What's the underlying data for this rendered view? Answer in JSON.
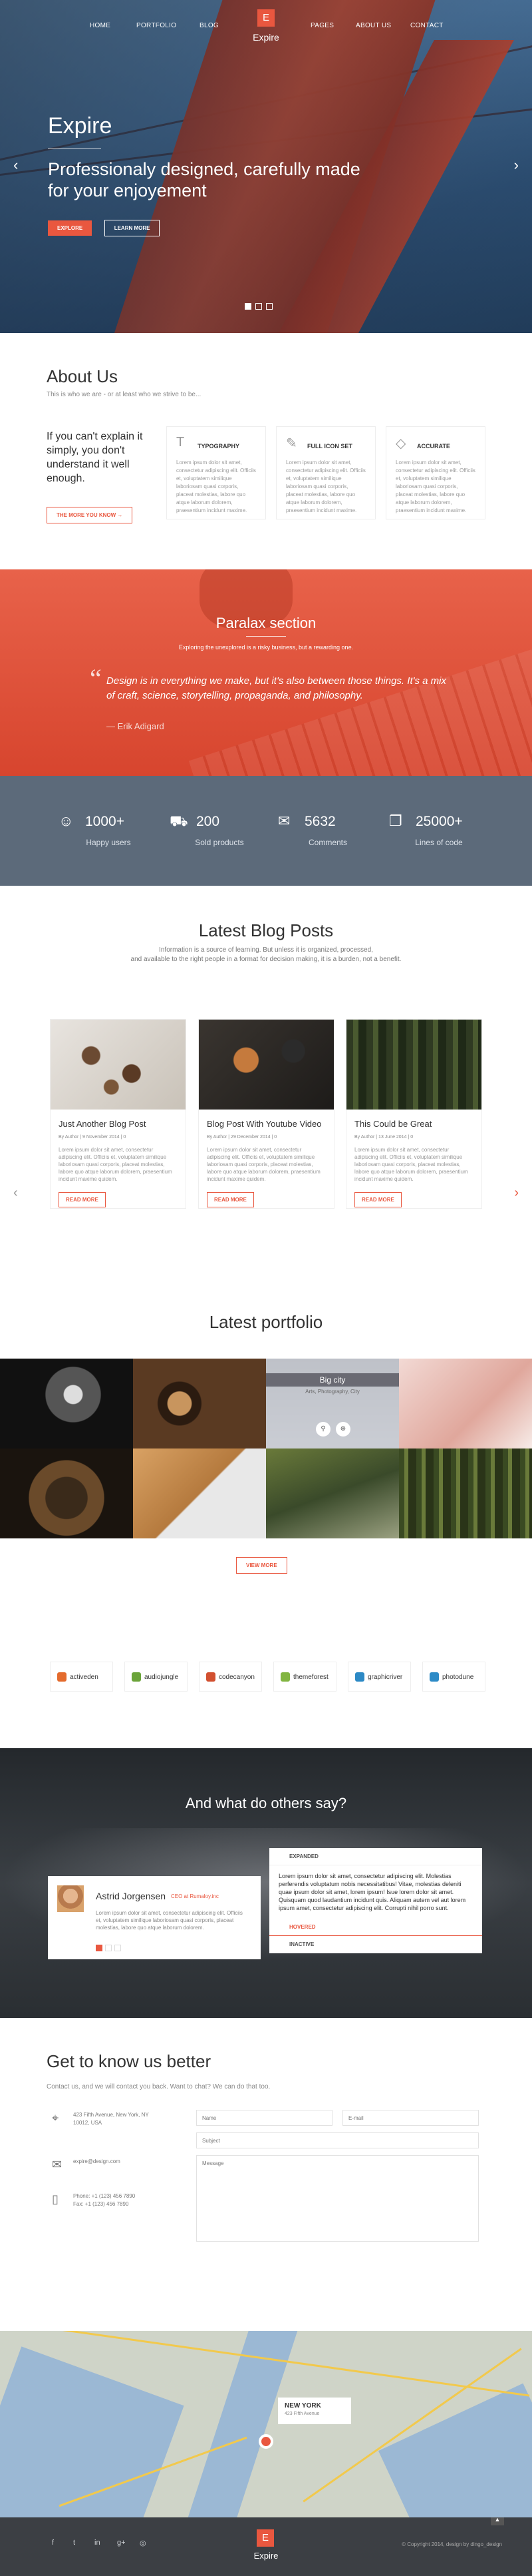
{
  "nav": {
    "left": [
      "HOME",
      "PORTFOLIO",
      "BLOG"
    ],
    "right": [
      "PAGES",
      "ABOUT US",
      "CONTACT"
    ],
    "logo_letter": "E",
    "logo_text": "Expire"
  },
  "hero": {
    "title": "Expire",
    "tagline_1": "Professionaly designed, carefully made",
    "tagline_2": "for your enjoyement",
    "btn_explore": "EXPLORE",
    "btn_learn": "LEARN MORE",
    "arrow_left": "‹",
    "arrow_right": "›"
  },
  "about": {
    "title": "About Us",
    "subtitle": "This is who we are - or at least who we strive to be...",
    "lead": "If you can't explain it simply, you don't understand it well enough.",
    "btn": "THE MORE YOU KNOW →",
    "features": [
      {
        "icon": "typography-icon",
        "glyph": "T",
        "title": "TYPOGRAPHY",
        "text": "Lorem ipsum dolor sit amet, consectetur adipiscing elit. Officiis et, voluptatem similique laboriosam quasi corporis, placeat molestias, labore quo atque laborum dolorem, praesentium incidunt maxime."
      },
      {
        "icon": "icon-set-icon",
        "glyph": "✎",
        "title": "FULL ICON SET",
        "text": "Lorem ipsum dolor sit amet, consectetur adipiscing elit. Officiis et, voluptatem similique laboriosam quasi corporis, placeat molestias, labore quo atque laborum dolorem, praesentium incidunt maxime."
      },
      {
        "icon": "accurate-icon",
        "glyph": "◇",
        "title": "ACCURATE",
        "text": "Lorem ipsum dolor sit amet, consectetur adipiscing elit. Officiis et, voluptatem similique laboriosam quasi corporis, placeat molestias, labore quo atque laborum dolorem, praesentium incidunt maxime."
      }
    ]
  },
  "parallax": {
    "title": "Paralax section",
    "subtitle": "Exploring the unexplored is a risky business, but a rewarding one.",
    "quote_mark": "“",
    "quote": "Design is in everything we make, but it's also between those things. It's a mix of craft, science, storytelling, propaganda, and philosophy.",
    "author": "— Erik Adigard"
  },
  "stats": [
    {
      "icon": "user-icon",
      "glyph": "☺",
      "num": "1000+",
      "label": "Happy users"
    },
    {
      "icon": "product-icon",
      "glyph": "⛟",
      "num": "200",
      "label": "Sold products"
    },
    {
      "icon": "comment-icon",
      "glyph": "✉",
      "num": "5632",
      "label": "Comments"
    },
    {
      "icon": "code-icon",
      "glyph": "❐",
      "num": "25000+",
      "label": "Lines of code"
    }
  ],
  "blog": {
    "title": "Latest Blog Posts",
    "desc_1": "Information is a source of learning. But unless it is organized, processed,",
    "desc_2": "and available to the right people in a format for decision making, it is a burden, not a benefit.",
    "arrow_left": "‹",
    "arrow_right": "›",
    "posts": [
      {
        "title": "Just Another Blog Post",
        "meta": "By Author  |  9 November 2014  |  0",
        "text": "Lorem ipsum dolor sit amet, consectetur adipiscing elit. Officiis et, voluptatem similique laboriosam quasi corporis, placeat molestias, labore quo atque laborum dolorem, praesentium incidunt maxime quidem.",
        "btn": "READ MORE",
        "accent": true
      },
      {
        "title": "Blog Post With Youtube Video",
        "meta": "By Author  |  29 December 2014  |  0",
        "text": "Lorem ipsum dolor sit amet, consectetur adipiscing elit. Officiis et, voluptatem similique laboriosam quasi corporis, placeat molestias, labore quo atque laborum dolorem, praesentium incidunt maxime quidem.",
        "btn": "READ MORE",
        "accent": false
      },
      {
        "title": "This Could be Great",
        "meta": "By Author  |  13 June 2014  |  0",
        "text": "Lorem ipsum dolor sit amet, consectetur adipiscing elit. Officiis et, voluptatem similique laboriosam quasi corporis, placeat molestias, labore quo atque laborum dolorem, praesentium incidunt maxime quidem.",
        "btn": "READ MORE",
        "accent": false
      }
    ]
  },
  "portfolio": {
    "title": "Latest portfolio",
    "hover_title": "Big city",
    "hover_sub": "Arts, Photography, City",
    "btn": "VIEW MORE"
  },
  "clients": [
    {
      "name": "activeden",
      "color": "#e46b2d"
    },
    {
      "name": "audiojungle",
      "color": "#6ba43a"
    },
    {
      "name": "codecanyon",
      "color": "#d25030"
    },
    {
      "name": "themeforest",
      "color": "#82b541"
    },
    {
      "name": "graphicriver",
      "color": "#2c89c5"
    },
    {
      "name": "photodune",
      "color": "#2d8bc7"
    }
  ],
  "testimonials": {
    "title": "And what do others say?",
    "name": "Astrid Jorgensen",
    "company": "CEO at Rumaloy.inc",
    "text": "Lorem ipsum dolor sit amet, consectetur adipiscing elit. Officiis et, voluptatem similique laboriosam quasi corporis, placeat molestias, labore quo atque laborum dolorem.",
    "acc_expanded": "EXPANDED",
    "acc_body": "Lorem ipsum dolor sit amet, consectetur adipiscing elit. Molestias perferendis voluptatum nobis necessitatibus! Vitae, molestias deleniti quae ipsum dolor sit amet, lorem ipsum! Isue lorem dolor sit amet. Quisquam quod laudantium incidunt quis. Aliquam autem vel aut lorem ipsum amet, consectetur adipiscing elit. Corrupti nihil porro sunt.",
    "acc_hovered": "HOVERED",
    "acc_inactive": "INACTIVE"
  },
  "contact": {
    "title": "Get to know us better",
    "subtitle": "Contact us, and we will contact you back. Want to chat? We can do that too.",
    "address": "423 Fifth Avenue, New York, NY 10012, USA",
    "email": "expire@design.com",
    "phone_1": "Phone: +1 (123) 456 7890",
    "phone_2": "Fax: +1 (123) 456 7890",
    "ph_name": "Name",
    "ph_email": "E-mail",
    "ph_subject": "Subject",
    "ph_message": "Message"
  },
  "map": {
    "city": "NEW YORK",
    "address": "423 Fifth Avenue"
  },
  "footer": {
    "social": [
      {
        "name": "facebook-icon",
        "glyph": "f"
      },
      {
        "name": "twitter-icon",
        "glyph": "t"
      },
      {
        "name": "linkedin-icon",
        "glyph": "in"
      },
      {
        "name": "googleplus-icon",
        "glyph": "g+"
      },
      {
        "name": "instagram-icon",
        "glyph": "◎"
      }
    ],
    "logo_letter": "E",
    "logo_text": "Expire",
    "copyright": "© Copyright 2014, design by dingo_design",
    "top": "▲"
  },
  "colors": {
    "accent": "#e9573f",
    "dark": "#3c3f44",
    "stats_bg": "#5c6a7a"
  }
}
